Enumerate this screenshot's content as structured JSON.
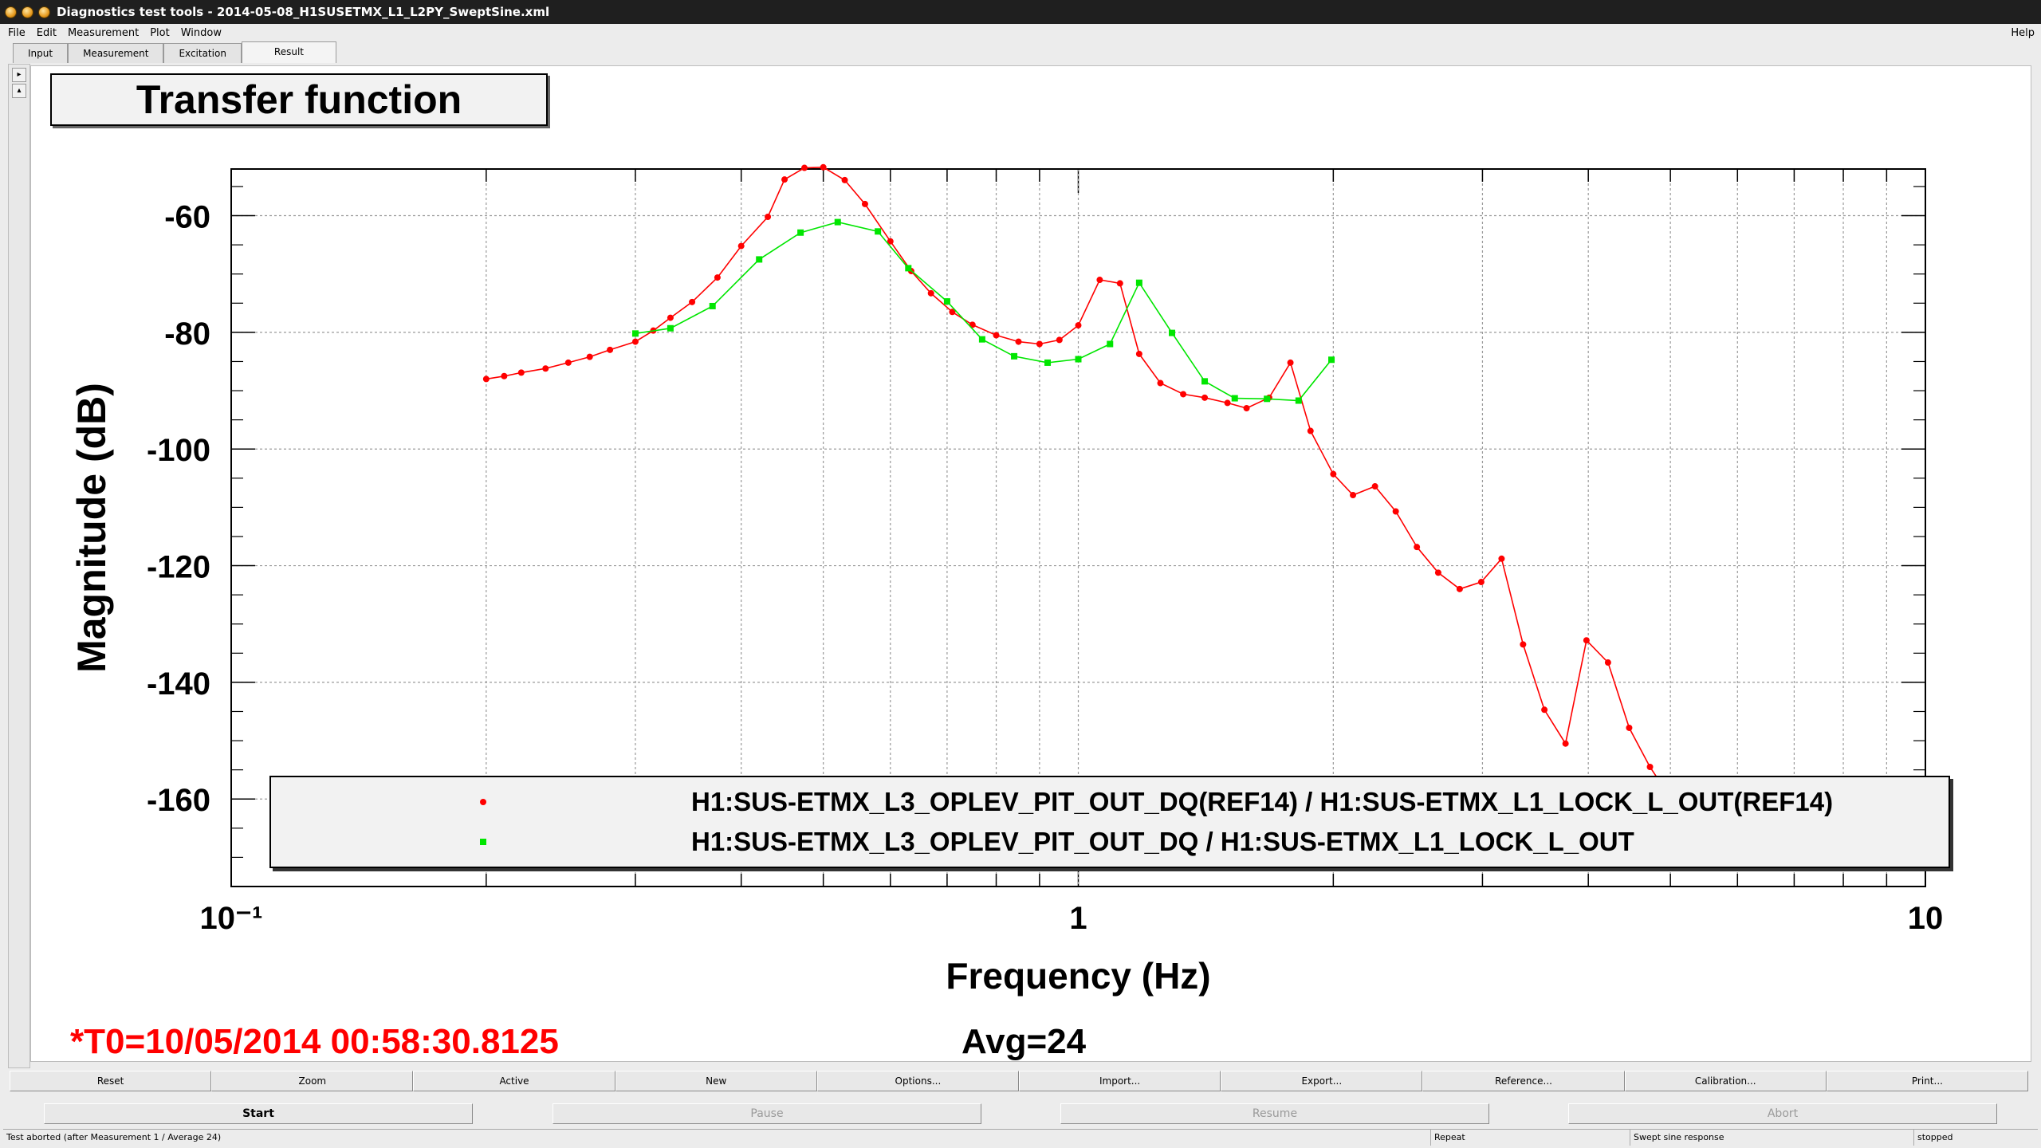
{
  "window": {
    "title": "Diagnostics test tools - 2014-05-08_H1SUSETMX_L1_L2PY_SweptSine.xml"
  },
  "menu": [
    "File",
    "Edit",
    "Measurement",
    "Plot",
    "Window"
  ],
  "menu_help": "Help",
  "tabs": [
    "Input",
    "Measurement",
    "Excitation",
    "Result"
  ],
  "active_tab": "Result",
  "plot": {
    "title": "Transfer function",
    "t0": "*T0=10/05/2014 00:58:30.8125",
    "avg": "Avg=24"
  },
  "chart_data": {
    "type": "line",
    "xscale": "log",
    "xlim": [
      0.1,
      10
    ],
    "ylim": [
      -175,
      -52
    ],
    "xlabel": "Frequency (Hz)",
    "ylabel": "Magnitude (dB)",
    "xticks": [
      "10⁻¹",
      "1",
      "10"
    ],
    "yticks": [
      -60,
      -80,
      -100,
      -120,
      -140,
      -160
    ],
    "grid": true,
    "legend_position": "bottom",
    "series": [
      {
        "name": "H1:SUS-ETMX_L3_OPLEV_PIT_OUT_DQ(REF14) / H1:SUS-ETMX_L1_LOCK_L_OUT(REF14)",
        "color": "#ff0000",
        "marker": "circle",
        "x": [
          0.2,
          0.21,
          0.22,
          0.235,
          0.25,
          0.265,
          0.28,
          0.3,
          0.315,
          0.33,
          0.35,
          0.375,
          0.4,
          0.43,
          0.45,
          0.475,
          0.5,
          0.53,
          0.56,
          0.6,
          0.635,
          0.67,
          0.71,
          0.75,
          0.8,
          0.85,
          0.9,
          0.95,
          1.0,
          1.06,
          1.12,
          1.18,
          1.25,
          1.33,
          1.41,
          1.5,
          1.58,
          1.68,
          1.78,
          1.88,
          2.0,
          2.11,
          2.24,
          2.37,
          2.51,
          2.66,
          2.82,
          2.99,
          3.16,
          3.35,
          3.55,
          3.76,
          3.98,
          4.22,
          4.47,
          4.73,
          5.01
        ],
        "y": [
          -88,
          -87.5,
          -86.9,
          -86.2,
          -85.2,
          -84.2,
          -83.0,
          -81.6,
          -79.7,
          -77.5,
          -74.8,
          -70.6,
          -65.2,
          -60.2,
          -53.8,
          -51.8,
          -51.7,
          -53.9,
          -58.0,
          -64.4,
          -69.5,
          -73.3,
          -76.5,
          -78.7,
          -80.5,
          -81.6,
          -82.0,
          -81.3,
          -78.8,
          -71.0,
          -71.6,
          -83.7,
          -88.7,
          -90.6,
          -91.2,
          -92.1,
          -93.0,
          -91.2,
          -85.2,
          -96.9,
          -104.3,
          -107.9,
          -106.4,
          -110.7,
          -116.8,
          -121.2,
          -124.0,
          -122.8,
          -118.8,
          -133.5,
          -144.7,
          -150.5,
          -132.8,
          -136.6,
          -147.8,
          -154.5,
          -160
        ]
      },
      {
        "name": "H1:SUS-ETMX_L3_OPLEV_PIT_OUT_DQ / H1:SUS-ETMX_L1_LOCK_L_OUT",
        "color": "#00e600",
        "marker": "square",
        "x": [
          0.3,
          0.33,
          0.37,
          0.42,
          0.47,
          0.52,
          0.58,
          0.63,
          0.7,
          0.77,
          0.84,
          0.92,
          1.0,
          1.09,
          1.18,
          1.29,
          1.41,
          1.53,
          1.67,
          1.82,
          1.99
        ],
        "y": [
          -80.2,
          -79.3,
          -75.5,
          -67.5,
          -62.9,
          -61.1,
          -62.7,
          -69.0,
          -74.7,
          -81.2,
          -84.1,
          -85.2,
          -84.6,
          -82.0,
          -71.5,
          -80.1,
          -88.4,
          -91.3,
          -91.4,
          -91.7,
          -84.7
        ]
      }
    ]
  },
  "buttons_row1": [
    "Reset",
    "Zoom",
    "Active",
    "New",
    "Options...",
    "Import...",
    "Export...",
    "Reference...",
    "Calibration...",
    "Print..."
  ],
  "buttons_row2": {
    "start": "Start",
    "pause": "Pause",
    "resume": "Resume",
    "abort": "Abort"
  },
  "status": {
    "message": "Test aborted (after Measurement 1 / Average 24)",
    "mode": "Repeat",
    "test_type": "Swept sine response",
    "state": "stopped"
  }
}
